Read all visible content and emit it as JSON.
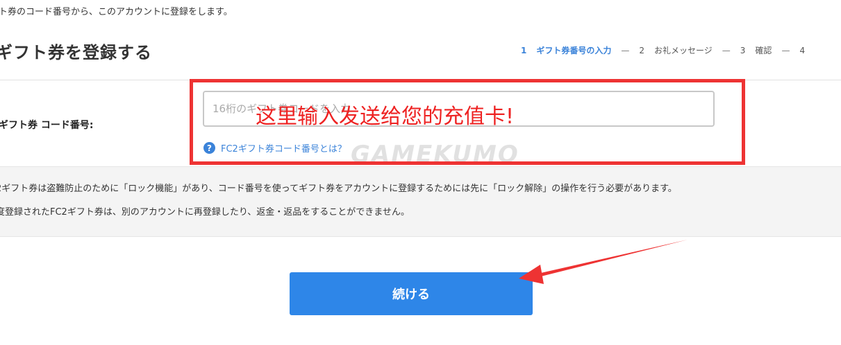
{
  "header": {
    "intro": "ト券のコード番号から、このアカウントに登録をします。",
    "title": "ギフト券を登録する"
  },
  "steps": [
    {
      "num": "1",
      "label": "ギフト券番号の入力",
      "active": true
    },
    {
      "num": "2",
      "label": "お礼メッセージ",
      "active": false
    },
    {
      "num": "3",
      "label": "確認",
      "active": false
    },
    {
      "num": "4",
      "label": "",
      "active": false
    }
  ],
  "form": {
    "field_label": "ギフト券 コード番号:",
    "code_placeholder": "16桁のギフト券コードを入力",
    "code_value": "",
    "help_link": "FC2ギフト券コード番号とは？",
    "help_icon": "?"
  },
  "notes": [
    "2ギフト券は盗難防止のために「ロック機能」があり、コード番号を使ってギフト券をアカウントに登録するためには先に「ロック解除」の操作を行う必要があります。",
    "度登録されたFC2ギフト券は、別のアカウントに再登録したり、返金・返品をすることができません。"
  ],
  "actions": {
    "continue_label": "続ける"
  },
  "annotation": {
    "text": "这里输入发送给您的充值卡!",
    "color": "#ee3333"
  },
  "watermark": "GAMEKUMO",
  "colors": {
    "accent": "#2e86e8",
    "link": "#3b83d9"
  }
}
